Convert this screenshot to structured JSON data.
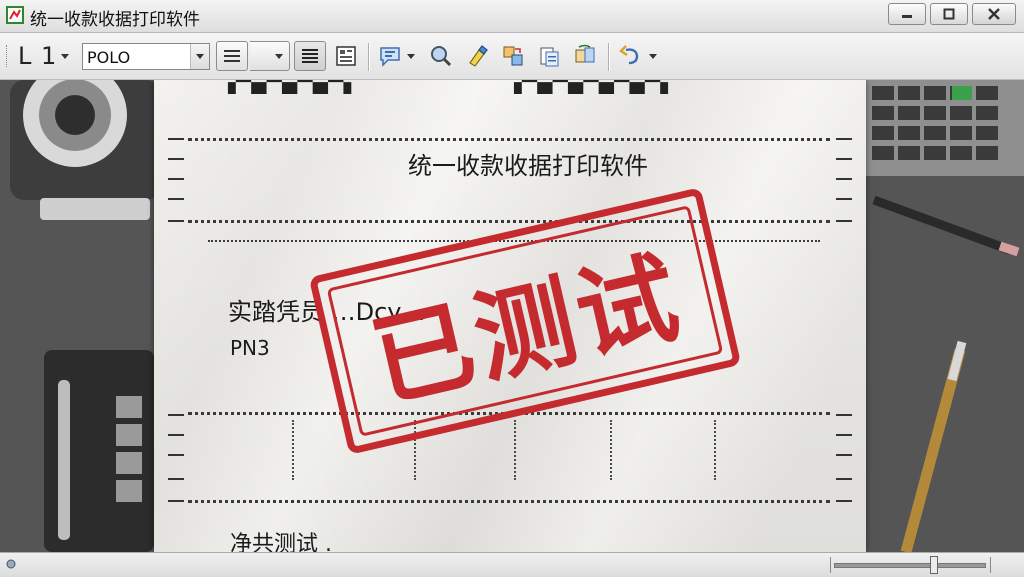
{
  "window": {
    "title": "统一收款收据打印软件"
  },
  "toolbar": {
    "zoom_label": "L 1",
    "font_combo_value": "POLO",
    "icons": [
      "align-lines-icon",
      "dropdown-arrow-icon",
      "align-justify-icon",
      "print-layout-icon",
      "comment-icon",
      "search-icon",
      "highlighter-icon",
      "copy-transfer-icon",
      "clipboard-icon",
      "replace-icon",
      "undo-icon"
    ]
  },
  "document": {
    "heading": "统一收款收据打印软件",
    "field_line_1": "实踏凭员 …Dcy…",
    "field_line_2": "PN3",
    "footer_text": "净共测试 ."
  },
  "stamp": {
    "text": "已测试",
    "color": "#c42a2e"
  },
  "colors": {
    "stamp_red": "#c42a2e",
    "paper": "#f1f0ed"
  }
}
